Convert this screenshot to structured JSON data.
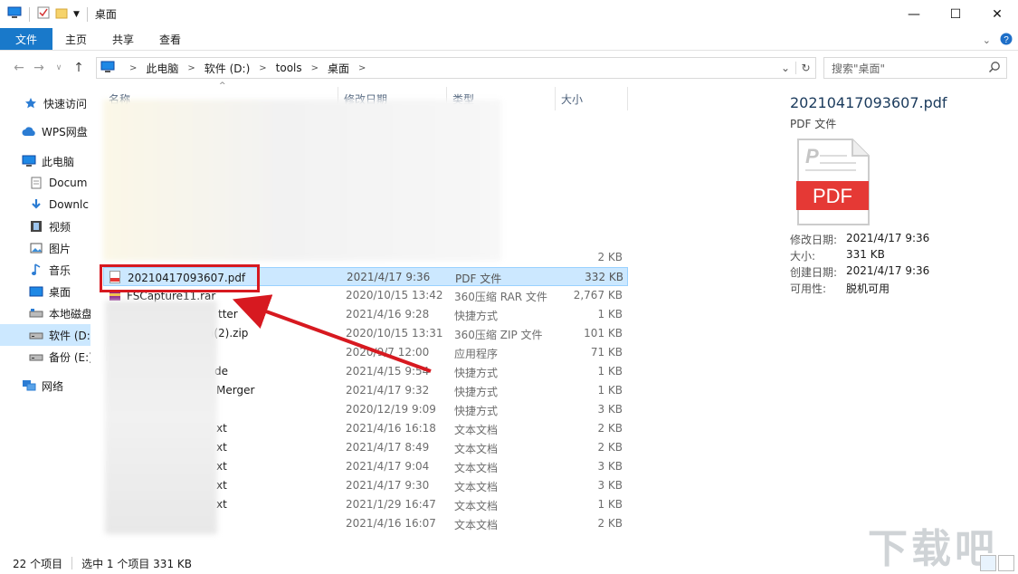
{
  "window": {
    "title": "桌面",
    "controls": [
      "—",
      "☐",
      "✕"
    ]
  },
  "ribbon": {
    "tabs": [
      "文件",
      "主页",
      "共享",
      "查看"
    ]
  },
  "address": {
    "crumbs": [
      "此电脑",
      "软件 (D:)",
      "tools",
      "桌面"
    ],
    "search_placeholder": "搜索\"桌面\""
  },
  "nav": {
    "items": [
      {
        "label": "快速访问",
        "icon": "star-icon"
      },
      {
        "label": "WPS网盘",
        "icon": "cloud-icon"
      },
      {
        "label": "此电脑",
        "icon": "computer-icon"
      },
      {
        "label": "Docum",
        "icon": "document-icon"
      },
      {
        "label": "Downlc",
        "icon": "download-icon"
      },
      {
        "label": "视频",
        "icon": "video-icon"
      },
      {
        "label": "图片",
        "icon": "picture-icon"
      },
      {
        "label": "音乐",
        "icon": "music-icon"
      },
      {
        "label": "桌面",
        "icon": "desktop-icon"
      },
      {
        "label": "本地磁盘",
        "icon": "drive-icon"
      },
      {
        "label": "软件 (D:)",
        "icon": "drive-icon"
      },
      {
        "label": "备份 (E:)",
        "icon": "drive-icon"
      },
      {
        "label": "网络",
        "icon": "network-icon"
      }
    ]
  },
  "columns": [
    "名称",
    "修改日期",
    "类型",
    "大小"
  ],
  "rows": [
    {
      "name": "",
      "date": "",
      "type": "",
      "size": "2 KB"
    },
    {
      "name": "20210417093607.pdf",
      "date": "2021/4/17 9:36",
      "type": "PDF 文件",
      "size": "332 KB"
    },
    {
      "name": "FSCapture11.rar",
      "date": "2020/10/15 13:42",
      "type": "360压缩 RAR 文件",
      "size": "2,767 KB"
    },
    {
      "name": "tter",
      "date": "2021/4/16 9:28",
      "type": "快捷方式",
      "size": "1 KB"
    },
    {
      "name": "a(2).zip",
      "date": "2020/10/15 13:31",
      "type": "360压缩 ZIP 文件",
      "size": "101 KB"
    },
    {
      "name": "",
      "date": "2020/9/7 12:00",
      "type": "应用程序",
      "size": "71 KB"
    },
    {
      "name": "de",
      "date": "2021/4/15 9:54",
      "type": "快捷方式",
      "size": "1 KB"
    },
    {
      "name": "Merger",
      "date": "2021/4/17 9:32",
      "type": "快捷方式",
      "size": "1 KB"
    },
    {
      "name": "",
      "date": "2020/12/19 9:09",
      "type": "快捷方式",
      "size": "3 KB"
    },
    {
      "name": "xt",
      "date": "2021/4/16 16:18",
      "type": "文本文档",
      "size": "2 KB"
    },
    {
      "name": "xt",
      "date": "2021/4/17 8:49",
      "type": "文本文档",
      "size": "2 KB"
    },
    {
      "name": "xt",
      "date": "2021/4/17 9:04",
      "type": "文本文档",
      "size": "3 KB"
    },
    {
      "name": "xt",
      "date": "2021/4/17 9:30",
      "type": "文本文档",
      "size": "3 KB"
    },
    {
      "name": "xt",
      "date": "2021/1/29 16:47",
      "type": "文本文档",
      "size": "1 KB"
    },
    {
      "name": "",
      "date": "2021/4/16 16:07",
      "type": "文本文档",
      "size": "2 KB"
    }
  ],
  "details": {
    "name": "20210417093607.pdf",
    "type": "PDF 文件",
    "icon_label": "PDF",
    "props": [
      {
        "k": "修改日期:",
        "v": "2021/4/17 9:36"
      },
      {
        "k": "大小:",
        "v": "331 KB"
      },
      {
        "k": "创建日期:",
        "v": "2021/4/17 9:36"
      },
      {
        "k": "可用性:",
        "v": "脱机可用"
      }
    ]
  },
  "status": {
    "count": "22 个项目",
    "selection": "选中 1 个项目  331 KB"
  },
  "watermark": "下载吧",
  "colors": {
    "accent": "#1979ca",
    "highlight": "#d71920",
    "selection": "#cce8ff"
  }
}
